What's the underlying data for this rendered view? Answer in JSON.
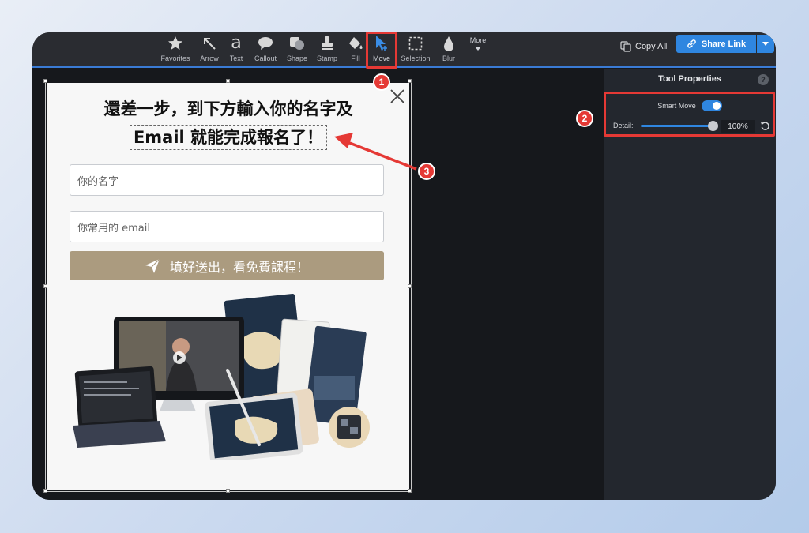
{
  "toolbar": {
    "tools": [
      {
        "label": "Favorites",
        "icon": "star-icon"
      },
      {
        "label": "Arrow",
        "icon": "arrow-icon"
      },
      {
        "label": "Text",
        "icon": "text-icon"
      },
      {
        "label": "Callout",
        "icon": "callout-icon"
      },
      {
        "label": "Shape",
        "icon": "shape-icon"
      },
      {
        "label": "Stamp",
        "icon": "stamp-icon"
      },
      {
        "label": "Fill",
        "icon": "fill-icon"
      },
      {
        "label": "Move",
        "icon": "move-icon"
      },
      {
        "label": "Selection",
        "icon": "selection-icon"
      },
      {
        "label": "Blur",
        "icon": "blur-icon"
      }
    ],
    "text_glyph": "a",
    "more_label": "More",
    "copy_all_label": "Copy All",
    "share_link_label": "Share Link",
    "accent_color": "#2f86e0"
  },
  "panel": {
    "title": "Tool Properties",
    "help": "?",
    "smart_move_label": "Smart Move",
    "smart_move_on": true,
    "detail_label": "Detail:",
    "detail_value": "100%",
    "detail_level": 1.0
  },
  "popup": {
    "headline_line1": "還差一步，到下方輸入你的名字及",
    "headline_line2": "Email 就能完成報名了！",
    "name_placeholder": "你的名字",
    "email_placeholder": "你常用的 email",
    "submit_label": "填好送出，看免費課程！",
    "button_color": "#ab9b7f"
  },
  "annotations": {
    "badge1": "1",
    "badge2": "2",
    "badge3": "3",
    "color": "#e53935"
  }
}
